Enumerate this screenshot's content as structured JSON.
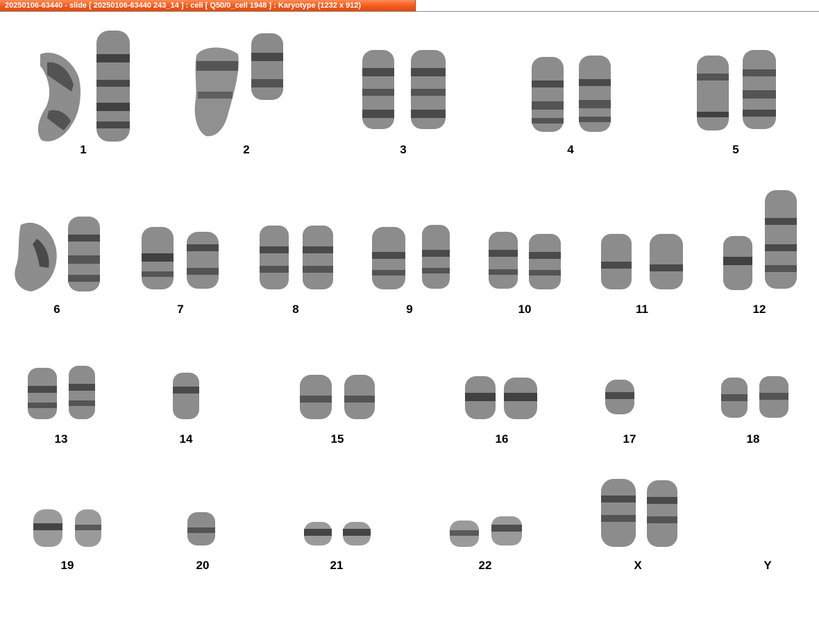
{
  "window": {
    "title": "20250106-63440 - slide [ 20250106-63440 243_14 ] : cell [ Q50/0_cell 1948 ] : Karyotype  (1232 x 912)"
  },
  "colors": {
    "titlebar_accent": "#f25a1c",
    "background": "#ffffff",
    "chromosome_dark": "#2b2b2b",
    "chromosome_light": "#9a9a9a"
  },
  "karyogram": {
    "rows": [
      {
        "pairs": [
          {
            "label": "1",
            "count": 2
          },
          {
            "label": "2",
            "count": 2
          },
          {
            "label": "3",
            "count": 2
          },
          {
            "label": "4",
            "count": 2
          },
          {
            "label": "5",
            "count": 2
          }
        ]
      },
      {
        "pairs": [
          {
            "label": "6",
            "count": 2
          },
          {
            "label": "7",
            "count": 2
          },
          {
            "label": "8",
            "count": 2
          },
          {
            "label": "9",
            "count": 2
          },
          {
            "label": "10",
            "count": 2
          },
          {
            "label": "11",
            "count": 2
          },
          {
            "label": "12",
            "count": 2
          }
        ]
      },
      {
        "pairs": [
          {
            "label": "13",
            "count": 2
          },
          {
            "label": "14",
            "count": 1
          },
          {
            "label": "15",
            "count": 2
          },
          {
            "label": "16",
            "count": 2
          },
          {
            "label": "17",
            "count": 1
          },
          {
            "label": "18",
            "count": 2
          }
        ]
      },
      {
        "pairs": [
          {
            "label": "19",
            "count": 2
          },
          {
            "label": "20",
            "count": 1
          },
          {
            "label": "21",
            "count": 2
          },
          {
            "label": "22",
            "count": 2
          },
          {
            "label": "X",
            "count": 2
          },
          {
            "label": "Y",
            "count": 0
          }
        ]
      }
    ]
  }
}
